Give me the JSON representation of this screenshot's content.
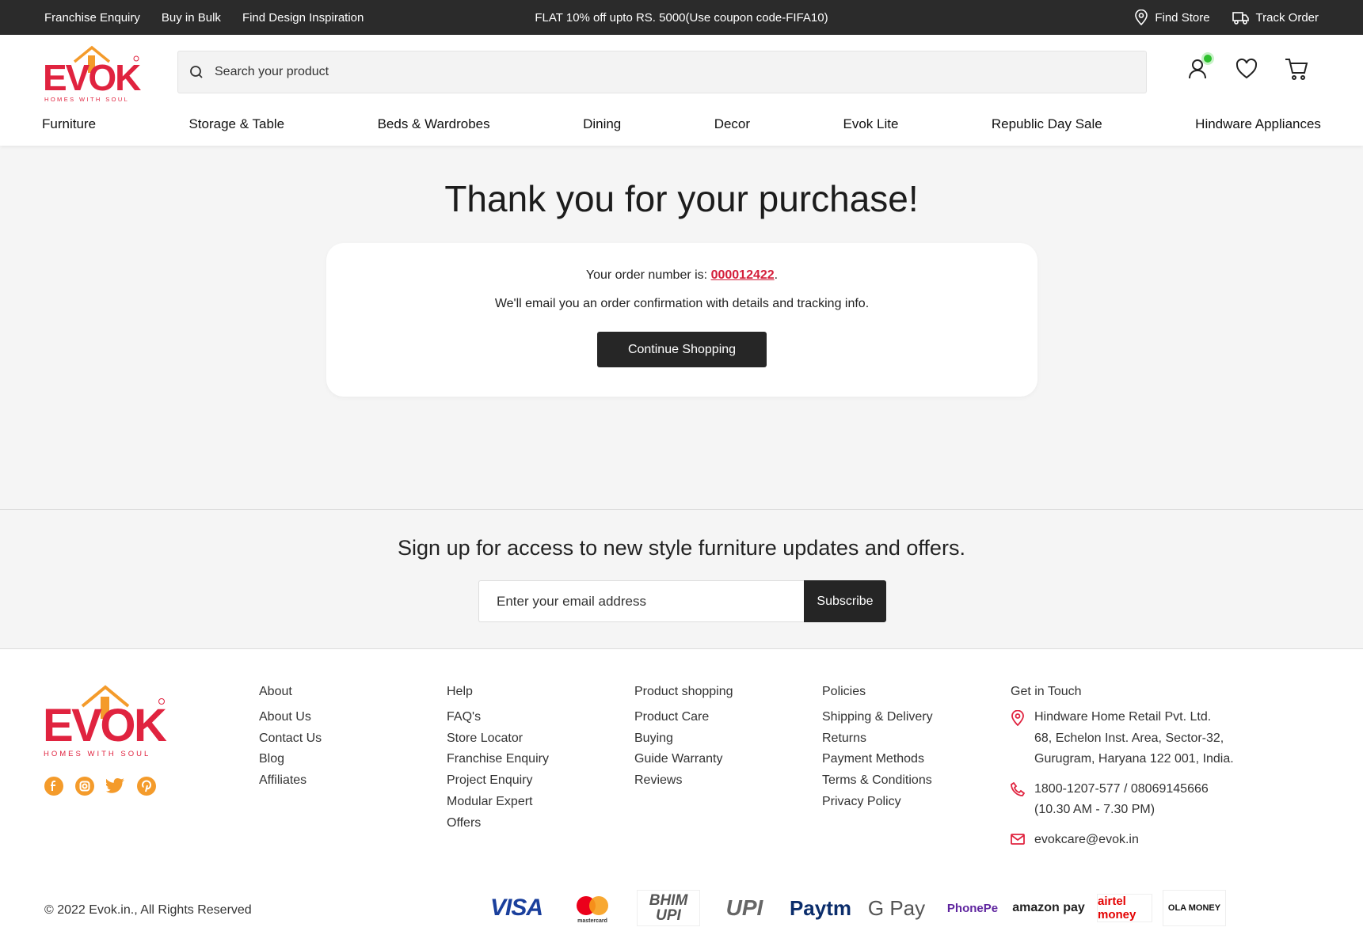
{
  "topbar": {
    "links": [
      "Franchise Enquiry",
      "Buy in Bulk",
      "Find Design Inspiration"
    ],
    "promo": "FLAT 10% off upto RS. 5000(Use coupon code-FIFA10)",
    "find_store": "Find Store",
    "track_order": "Track Order"
  },
  "header": {
    "logo_text": "EVOK",
    "logo_tagline": "HOMES WITH SOUL",
    "search_placeholder": "Search your product",
    "nav": [
      "Furniture",
      "Storage & Table",
      "Beds & Wardrobes",
      "Dining",
      "Decor",
      "Evok Lite",
      "Republic Day Sale",
      "Hindware Appliances"
    ]
  },
  "confirmation": {
    "title": "Thank you for your purchase!",
    "order_prefix": "Your order number is: ",
    "order_number": "000012422",
    "order_suffix": ".",
    "email_note": "We'll email you an order confirmation with details and tracking info.",
    "continue_label": "Continue Shopping"
  },
  "newsletter": {
    "heading": "Sign up for access to new style furniture updates and offers.",
    "email_placeholder": "Enter your email address",
    "subscribe_label": "Subscribe"
  },
  "footer": {
    "socials": [
      "facebook-icon",
      "instagram-icon",
      "twitter-icon",
      "pinterest-icon"
    ],
    "about": {
      "title": "About",
      "links": [
        "About Us",
        "Contact Us",
        "Blog",
        "Affiliates"
      ]
    },
    "help": {
      "title": "Help",
      "links": [
        "FAQ's",
        "Store Locator",
        "Franchise Enquiry",
        "Project Enquiry",
        "Modular Expert",
        "Offers"
      ]
    },
    "product": {
      "title": "Product shopping",
      "links": [
        "Product Care",
        "Buying",
        "Guide Warranty",
        "Reviews"
      ]
    },
    "policies": {
      "title": "Policies",
      "links": [
        "Shipping & Delivery",
        "Returns",
        "Payment Methods",
        "Terms & Conditions",
        "Privacy Policy"
      ]
    },
    "contact": {
      "title": "Get in Touch",
      "address_1": "Hindware Home Retail Pvt. Ltd.",
      "address_2": "68, Echelon Inst. Area, Sector-32,",
      "address_3": "Gurugram, Haryana 122 001, India.",
      "phone": "1800-1207-577 / 08069145666",
      "hours": "(10.30 AM - 7.30 PM)",
      "email": "evokcare@evok.in"
    },
    "copyright": "© 2022 Evok.in., All Rights Reserved",
    "payments": [
      "VISA",
      "mastercard",
      "BHIM UPI",
      "UPI",
      "Paytm",
      "G Pay",
      "PhonePe",
      "amazon pay",
      "airtel money",
      "OLA MONEY"
    ]
  },
  "colors": {
    "brand_red": "#e0233f",
    "brand_orange": "#f49b2b",
    "dark": "#262626",
    "online": "#2ec02e"
  }
}
